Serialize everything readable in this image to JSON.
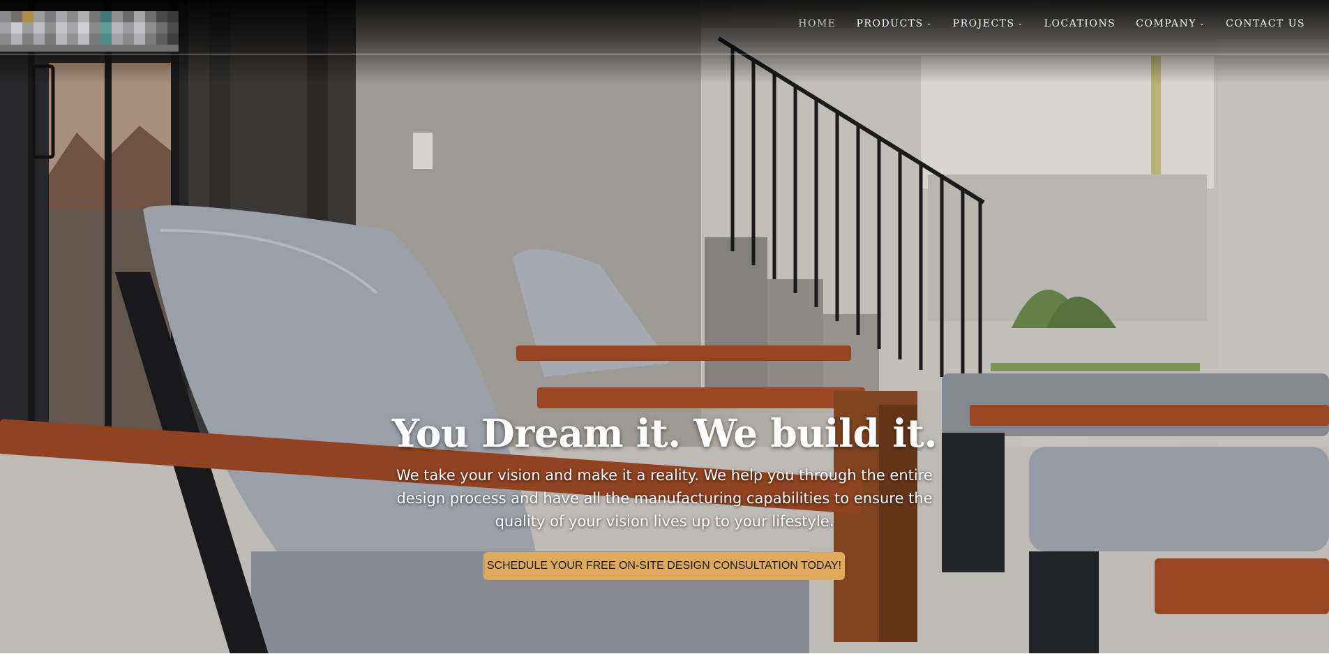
{
  "nav": {
    "items": [
      {
        "label": "HOME",
        "active": true,
        "dropdown": false
      },
      {
        "label": "PRODUCTS",
        "active": false,
        "dropdown": true
      },
      {
        "label": "PROJECTS",
        "active": false,
        "dropdown": true
      },
      {
        "label": "LOCATIONS",
        "active": false,
        "dropdown": false
      },
      {
        "label": "COMPANY",
        "active": false,
        "dropdown": true
      },
      {
        "label": "CONTACT US",
        "active": false,
        "dropdown": false
      }
    ],
    "dropdown_icon": "chevron-down-icon"
  },
  "hero": {
    "headline": "You Dream it. We build it.",
    "subtext": "We take your vision and make it a reality. We help you through the entire design process and have all the manufacturing capabilities to ensure the quality of your vision lives up to your lifestyle.",
    "cta_label": "SCHEDULE YOUR FREE ON-SITE DESIGN CONSULTATION TODAY!"
  },
  "colors": {
    "cta_background": "#deaa5c",
    "nav_text": "#ffffff",
    "nav_active_text": "#c9c9c9",
    "wood_accent": "#a34a24",
    "cushion": "#a9adb6"
  }
}
